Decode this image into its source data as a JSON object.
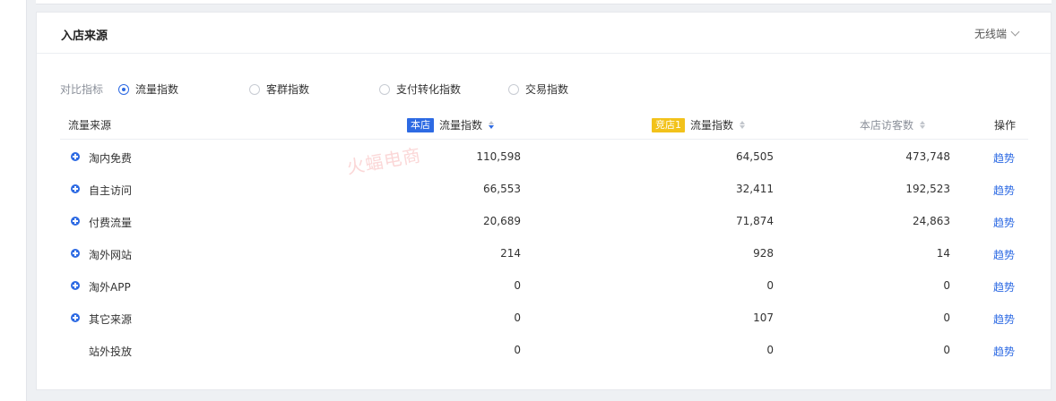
{
  "card": {
    "title": "入店来源",
    "device": "无线端"
  },
  "compare": {
    "label": "对比指标",
    "options": [
      {
        "label": "流量指数",
        "checked": true
      },
      {
        "label": "客群指数",
        "checked": false
      },
      {
        "label": "支付转化指数",
        "checked": false
      },
      {
        "label": "交易指数",
        "checked": false
      }
    ]
  },
  "table": {
    "headers": {
      "source": "流量来源",
      "own_badge": "本店",
      "own_metric": "流量指数",
      "rival_badge": "竞店1",
      "rival_metric": "流量指数",
      "visitors": "本店访客数",
      "action": "操作"
    },
    "rows": [
      {
        "source": "淘内免费",
        "own": "110,598",
        "rival": "64,505",
        "visitors": "473,748",
        "action": "趋势"
      },
      {
        "source": "自主访问",
        "own": "66,553",
        "rival": "32,411",
        "visitors": "192,523",
        "action": "趋势"
      },
      {
        "source": "付费流量",
        "own": "20,689",
        "rival": "71,874",
        "visitors": "24,863",
        "action": "趋势"
      },
      {
        "source": "淘外网站",
        "own": "214",
        "rival": "928",
        "visitors": "14",
        "action": "趋势"
      },
      {
        "source": "淘外APP",
        "own": "0",
        "rival": "0",
        "visitors": "0",
        "action": "趋势"
      },
      {
        "source": "其它来源",
        "own": "0",
        "rival": "107",
        "visitors": "0",
        "action": "趋势"
      },
      {
        "source": "站外投放",
        "own": "0",
        "rival": "0",
        "visitors": "0",
        "action": "趋势"
      }
    ]
  },
  "watermark": "火蝠电商",
  "colors": {
    "accent": "#2d6ae3",
    "rival": "#f2c21b"
  }
}
